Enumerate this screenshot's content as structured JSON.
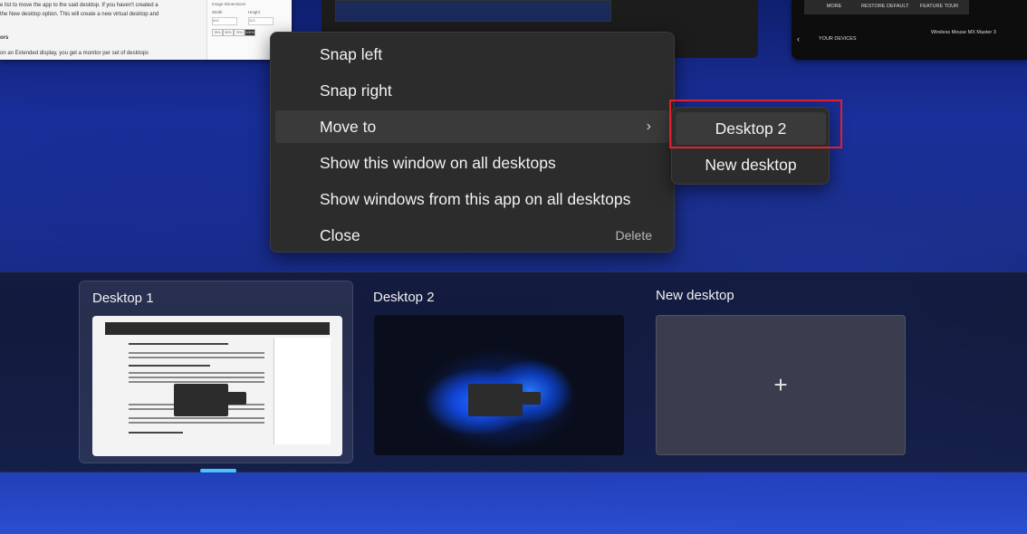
{
  "context_menu": {
    "items": [
      {
        "label": "Snap left"
      },
      {
        "label": "Snap right"
      },
      {
        "label": "Move to"
      },
      {
        "label": "Show this window on all desktops"
      },
      {
        "label": "Show windows from this app on all desktops"
      },
      {
        "label": "Close",
        "shortcut": "Delete"
      }
    ],
    "submenu_chevron": "›"
  },
  "submenu": {
    "items": [
      {
        "label": "Desktop 2"
      },
      {
        "label": "New desktop"
      }
    ]
  },
  "desktops": [
    {
      "label": "Desktop 1"
    },
    {
      "label": "Desktop 2"
    },
    {
      "label": "New desktop",
      "add_icon": "+"
    }
  ],
  "background_windows": {
    "doc": {
      "lines": [
        "e list to move the app to the said desktop. If you haven't created a",
        "the New desktop option. This will create a new virtual desktop and",
        "ors",
        "on an Extended display, you get a monitor per set of desktops"
      ],
      "panel_title": "Image Dimensions",
      "width_label": "Width",
      "height_label": "Height",
      "width_value": "600",
      "height_value": "320",
      "percent_buttons": [
        "25%",
        "50%",
        "75%",
        "100%"
      ]
    },
    "phone": {
      "buttons": [
        "MORE",
        "RESTORE DEFAULTS",
        "FEATURE TOUR"
      ],
      "back_label": "YOUR DEVICES",
      "device_name": "Wireless Mouse MX Master 3"
    }
  },
  "colors": {
    "menu_bg": "#2c2c2c",
    "accent": "#4cc2ff",
    "highlight_border": "#e0202a"
  }
}
